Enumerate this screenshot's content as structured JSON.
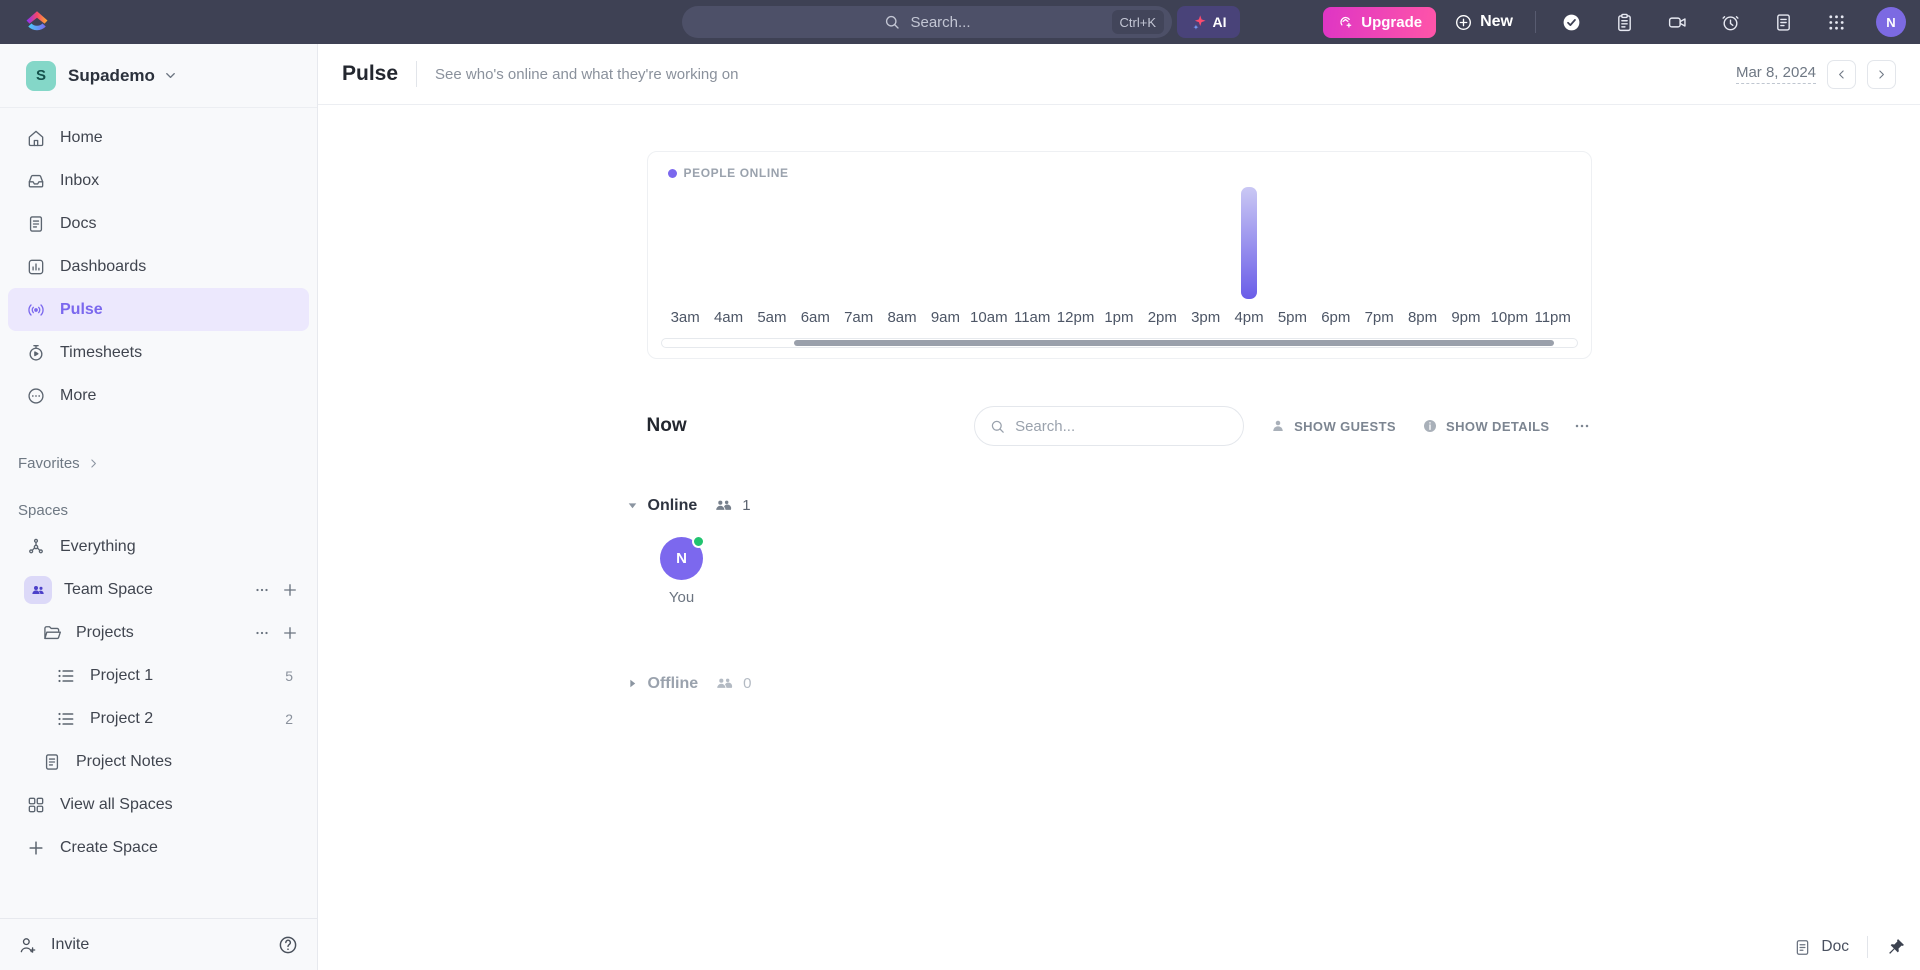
{
  "topbar": {
    "search_placeholder": "Search...",
    "shortcut": "Ctrl+K",
    "ai_label": "AI",
    "upgrade_label": "Upgrade",
    "new_label": "New",
    "avatar_initial": "N"
  },
  "sidebar": {
    "workspace": {
      "initial": "S",
      "name": "Supademo"
    },
    "nav": [
      {
        "label": "Home"
      },
      {
        "label": "Inbox"
      },
      {
        "label": "Docs"
      },
      {
        "label": "Dashboards"
      },
      {
        "label": "Pulse"
      },
      {
        "label": "Timesheets"
      },
      {
        "label": "More"
      }
    ],
    "favorites_label": "Favorites",
    "spaces_label": "Spaces",
    "spaces": [
      {
        "label": "Everything"
      },
      {
        "label": "Team Space"
      },
      {
        "label": "Projects"
      },
      {
        "label": "Project 1",
        "count": "5"
      },
      {
        "label": "Project 2",
        "count": "2"
      },
      {
        "label": "Project Notes"
      },
      {
        "label": "View all Spaces"
      },
      {
        "label": "Create Space"
      }
    ],
    "invite_label": "Invite"
  },
  "header": {
    "title": "Pulse",
    "subtitle": "See who's online and what they're working on",
    "date": "Mar 8, 2024"
  },
  "chart_data": {
    "type": "bar",
    "title": "PEOPLE ONLINE",
    "categories": [
      "3am",
      "4am",
      "5am",
      "6am",
      "7am",
      "8am",
      "9am",
      "10am",
      "11am",
      "12pm",
      "1pm",
      "2pm",
      "3pm",
      "4pm",
      "5pm",
      "6pm",
      "7pm",
      "8pm",
      "9pm",
      "10pm",
      "11pm"
    ],
    "values": [
      0,
      0,
      0,
      0,
      0,
      0,
      0,
      0,
      0,
      0,
      0,
      0,
      0,
      1,
      0,
      0,
      0,
      0,
      0,
      0,
      0
    ],
    "xlabel": "",
    "ylabel": "",
    "ylim": [
      0,
      1
    ],
    "grid": false,
    "legend_position": "top-left",
    "bar_color_top": "#cac8f4",
    "bar_color_bottom": "#6a5de8"
  },
  "now": {
    "title": "Now",
    "search_placeholder": "Search...",
    "show_guests": "SHOW GUESTS",
    "show_details": "SHOW DETAILS"
  },
  "groups": {
    "online": {
      "label": "Online",
      "count": "1"
    },
    "offline": {
      "label": "Offline",
      "count": "0"
    }
  },
  "member": {
    "initial": "N",
    "label": "You"
  },
  "footer": {
    "doc_label": "Doc"
  },
  "colors": {
    "accent_purple": "#7b68ee",
    "topbar_bg": "#3e4154",
    "upgrade_gradient_start": "#de35c5",
    "upgrade_gradient_end": "#ff55a8",
    "online_green": "#21c36f",
    "workspace_avatar": "#84d7c8"
  }
}
